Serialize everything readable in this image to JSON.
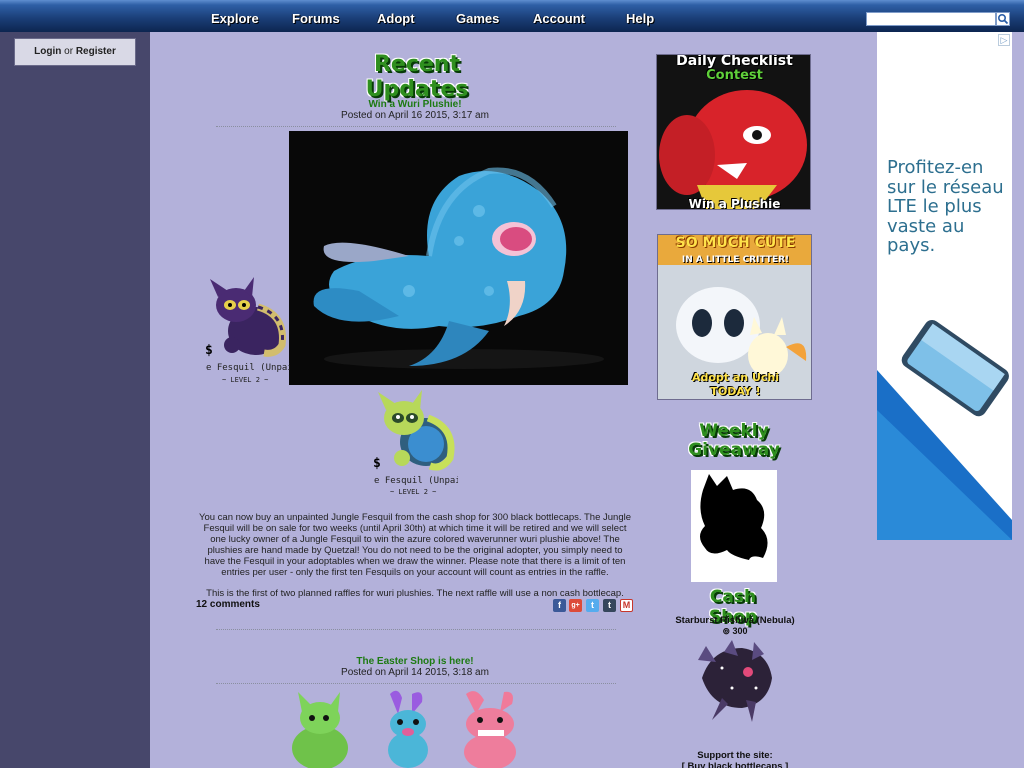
{
  "nav": {
    "items": [
      "Explore",
      "Forums",
      "Adopt",
      "Games",
      "Account",
      "Help"
    ],
    "search_placeholder": ""
  },
  "sidebar": {
    "login": "Login",
    "or": "or",
    "register": "Register"
  },
  "main": {
    "heading": "Recent Updates",
    "posts": [
      {
        "title": "Win a Wuri Plushie!",
        "date": "Posted on April 16 2015, 3:17 am",
        "pets": [
          {
            "name": "e Fesquil (Unpair",
            "level": "~ LEVEL 2 ~",
            "currency": "$"
          },
          {
            "name": "e Fesquil (Unpair",
            "level": "~ LEVEL 2 ~",
            "currency": "$"
          }
        ],
        "body": "You can now buy an unpainted Jungle Fesquil from the cash shop for 300 black bottlecaps. The Jungle Fesquil will be on sale for two weeks (until April 30th) at which time it will be retired and we will select one lucky owner of a Jungle Fesquil to win the azure colored waverunner wuri plushie above! The plushies are hand made by Quetzal! You do not need to be the original adopter, you simply need to have the Fesquil in your adoptables when we draw the winner. Please note that there is a limit of ten entries per user - only the first ten Fesquils on your account will count as entries in the raffle.",
        "body2": "This is the first of two planned raffles for wuri plushies. The next raffle will use a non cash bottlecap.",
        "comments": "12 comments",
        "share_icons": [
          "facebook-icon",
          "google-plus-icon",
          "twitter-icon",
          "tumblr-icon",
          "email-icon"
        ]
      },
      {
        "title": "The Easter Shop is here!",
        "date": "Posted on April 14 2015, 3:18 am"
      }
    ]
  },
  "right": {
    "daily_checklist": {
      "line1": "Daily Checklist",
      "line2": "Contest",
      "footer": "Win a Plushie"
    },
    "so_much_cute": {
      "line1": "SO MUCH CUTE",
      "line2": "IN A LITTLE CRITTER!",
      "footer1": "Adopt an Uchi",
      "footer2": "TODAY !"
    },
    "weekly_giveaway": {
      "line1": "Weekly",
      "line2": "Giveaway"
    },
    "cash_shop": {
      "title": "Cash Shop",
      "item_name": "Starburst Rishiva (Nebula)",
      "item_price": "300",
      "price_icon": "bottlecap-icon"
    },
    "support": {
      "label": "Support the site:",
      "link": "[ Buy black bottlecaps ]"
    }
  },
  "ad": {
    "text": "Profitez-en sur le réseau LTE le plus vaste au pays.",
    "badge": "▷"
  }
}
